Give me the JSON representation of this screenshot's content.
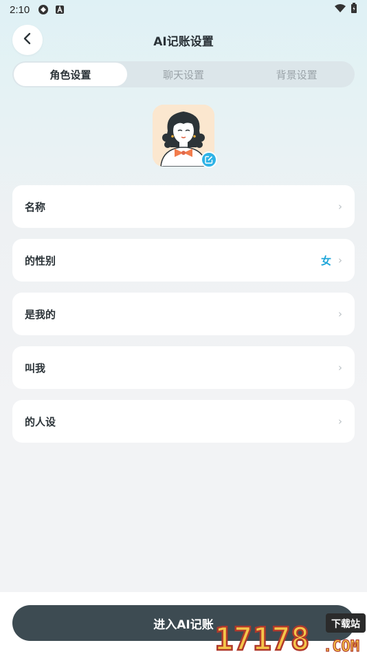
{
  "status_bar": {
    "time": "2:10"
  },
  "header": {
    "title": "AI记账设置"
  },
  "tabs": [
    {
      "label": "角色设置",
      "active": true
    },
    {
      "label": "聊天设置",
      "active": false
    },
    {
      "label": "背景设置",
      "active": false
    }
  ],
  "settings": [
    {
      "label": "名称",
      "value": ""
    },
    {
      "label": "的性别",
      "value": "女"
    },
    {
      "label": "是我的",
      "value": ""
    },
    {
      "label": "叫我",
      "value": ""
    },
    {
      "label": "的人设",
      "value": ""
    }
  ],
  "chevron": "›",
  "footer": {
    "enter_label": "进入AI记账"
  },
  "watermark": {
    "number": "17178",
    "suffix": ".COM",
    "tag": "下载站"
  },
  "colors": {
    "accent": "#2fb3e6",
    "button_dark": "#3d4b52",
    "female_value": "#1fa6d9"
  }
}
